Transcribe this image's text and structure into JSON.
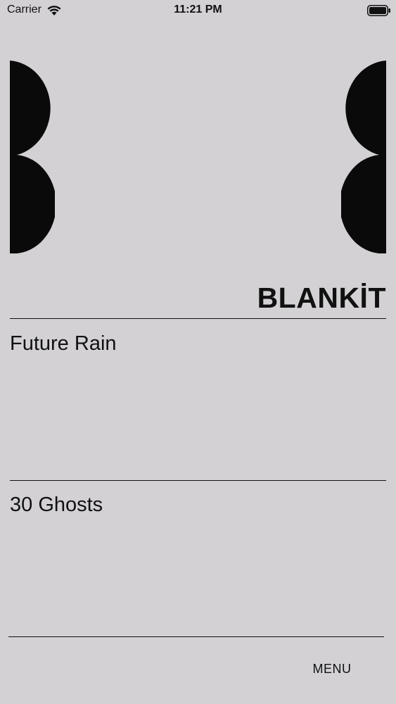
{
  "status_bar": {
    "carrier": "Carrier",
    "time": "11:21 PM",
    "wifi_icon": "wifi-icon",
    "battery_icon": "battery-icon"
  },
  "logo": {
    "brand": "BLANKİT",
    "left_mark_icon": "double-half-circle-icon",
    "right_mark_icon": "double-half-circle-icon"
  },
  "items": [
    {
      "label": "Future Rain"
    },
    {
      "label": "30 Ghosts"
    }
  ],
  "menu": {
    "label": "MENU"
  },
  "colors": {
    "background": "#d3d1d4",
    "foreground": "#111111"
  }
}
